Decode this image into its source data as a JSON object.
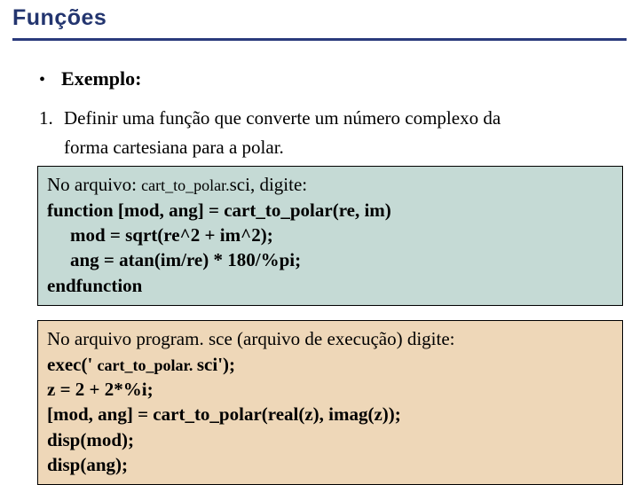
{
  "title": "Funções",
  "example_label": "Exemplo:",
  "step": {
    "number": "1.",
    "text_line1": "Definir uma função que converte um número complexo da",
    "text_line2": "forma cartesiana para a polar."
  },
  "func_box": {
    "intro_prefix": "No arquivo: ",
    "intro_filename": "cart_to_polar.",
    "intro_suffix": "sci, digite:",
    "code": [
      "function [mod, ang] = cart_to_polar(re, im)",
      "mod = sqrt(re^2 + im^2);",
      "ang = atan(im/re) * 180/%pi;",
      "endfunction"
    ]
  },
  "prog_box": {
    "intro": "No arquivo program. sce (arquivo de execução) digite:",
    "code_exec_prefix": "exec(' ",
    "code_exec_file": "cart_to_polar. ",
    "code_exec_suffix": "sci');",
    "code": [
      "z = 2 + 2*%i;",
      "[mod, ang] = cart_to_polar(real(z), imag(z));",
      "disp(mod);",
      "disp(ang);"
    ]
  }
}
